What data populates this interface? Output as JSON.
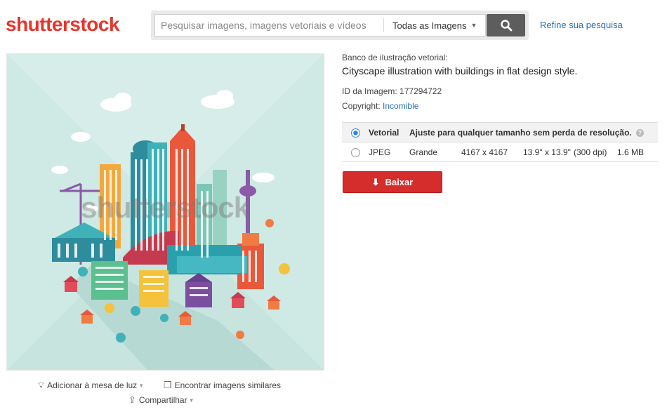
{
  "header": {
    "logo_text": "shutterstock",
    "search_placeholder": "Pesquisar imagens, imagens vetoriais e vídeos",
    "category_select": "Todas as Imagens",
    "search_button_icon": "search-icon",
    "refine_link": "Refine sua pesquisa"
  },
  "image": {
    "watermark": "shutterstock",
    "actions": {
      "lightbox": "Adicionar à mesa de luz",
      "similar": "Encontrar imagens similares",
      "share": "Compartilhar"
    }
  },
  "details": {
    "category": "Banco de ilustração vetorial:",
    "title": "Cityscape illustration with buildings in flat design style.",
    "image_id_label": "ID da Imagem:",
    "image_id": "177294722",
    "copyright_label": "Copyright:",
    "copyright_owner": "Incomible"
  },
  "options": [
    {
      "format": "Vetorial",
      "description": "Ajuste para qualquer tamanho sem perda de resolução.",
      "selected": true
    },
    {
      "format": "JPEG",
      "size_name": "Grande",
      "pixels": "4167 x 4167",
      "print": "13.9\" x 13.9\"",
      "dpi": "(300 dpi)",
      "filesize": "1.6 MB",
      "selected": false
    }
  ],
  "download_button": "Baixar",
  "colors": {
    "brand_red": "#e8342b",
    "download_red": "#d52c2c",
    "link_blue": "#2a6fb2",
    "image_background": "#cfe9e4"
  }
}
